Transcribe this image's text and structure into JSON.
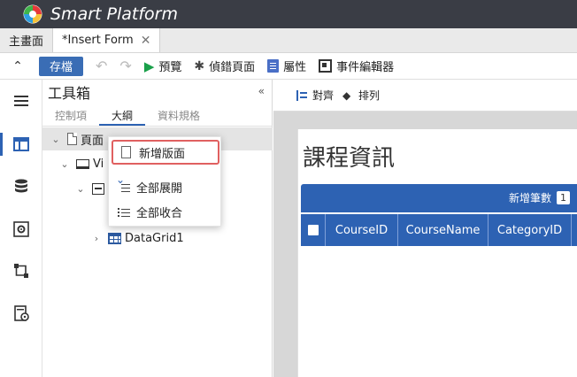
{
  "app": {
    "title": "Smart Platform"
  },
  "tabs": [
    {
      "label": "主畫面"
    },
    {
      "label": "*Insert Form",
      "close": "✕"
    }
  ],
  "toolbar": {
    "collapse_icon": "double-chevron-up-icon",
    "save_label": "存檔",
    "undo_icon": "undo-icon",
    "redo_icon": "redo-icon",
    "preview_label": "預覽",
    "debug_label": "偵錯頁面",
    "property_label": "屬性",
    "event_editor_label": "事件編輯器"
  },
  "toolbox": {
    "title": "工具箱",
    "collapse_icon": "double-chevron-left-icon",
    "subtabs": [
      "控制項",
      "大綱",
      "資料規格"
    ],
    "active_subtab": 1,
    "tree": {
      "page_label": "頁面",
      "view_label": "Vi",
      "datagrid_label": "DataGrid1"
    }
  },
  "context_menu": {
    "items": [
      "新增版面",
      "全部展開",
      "全部收合"
    ]
  },
  "designer": {
    "align_label": "對齊",
    "arrange_label": "排列",
    "form_title": "課程資訊",
    "add_count_label": "新增筆數",
    "add_count_value": "1",
    "columns": [
      "CourseID",
      "CourseName",
      "CategoryID"
    ]
  },
  "colors": {
    "accent": "#2d62b3",
    "titlebar": "#3a3d45",
    "save": "#3a6db5",
    "highlight": "#e06060"
  }
}
